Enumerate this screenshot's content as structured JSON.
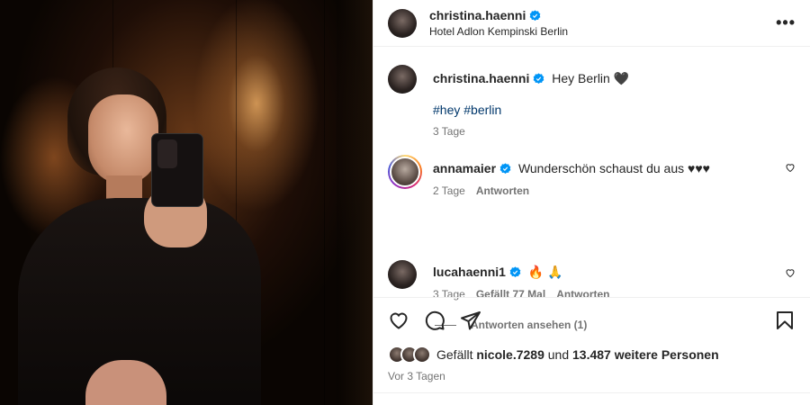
{
  "post": {
    "author": "christina.haenni",
    "location": "Hotel Adlon Kempinski Berlin",
    "more_label": "•••"
  },
  "caption": {
    "author": "christina.haenni",
    "text": "Hey Berlin 🖤",
    "hashtags": "#hey #berlin",
    "time": "3 Tage"
  },
  "comments": [
    {
      "author": "annamaier",
      "text": "Wunderschön schaust du aus ♥♥♥",
      "time": "2 Tage",
      "reply_label": "Antworten"
    },
    {
      "author": "lucahaenni1",
      "text": "🔥 🙏",
      "time": "3 Tage",
      "likes_label": "Gefällt 77 Mal",
      "reply_label": "Antworten"
    }
  ],
  "view_replies": "Antworten ansehen (1)",
  "likes": {
    "prefix": "Gefällt",
    "user": "nicole.7289",
    "middle": "und",
    "count": "13.487 weitere Personen"
  },
  "date": "Vor 3 Tagen",
  "colors": {
    "verified": "#0095f6",
    "hashtag": "#00376b",
    "muted": "#737373"
  },
  "icons": [
    "verified-badge-icon",
    "more-options-icon",
    "heart-icon",
    "comment-icon",
    "share-icon",
    "save-icon"
  ]
}
